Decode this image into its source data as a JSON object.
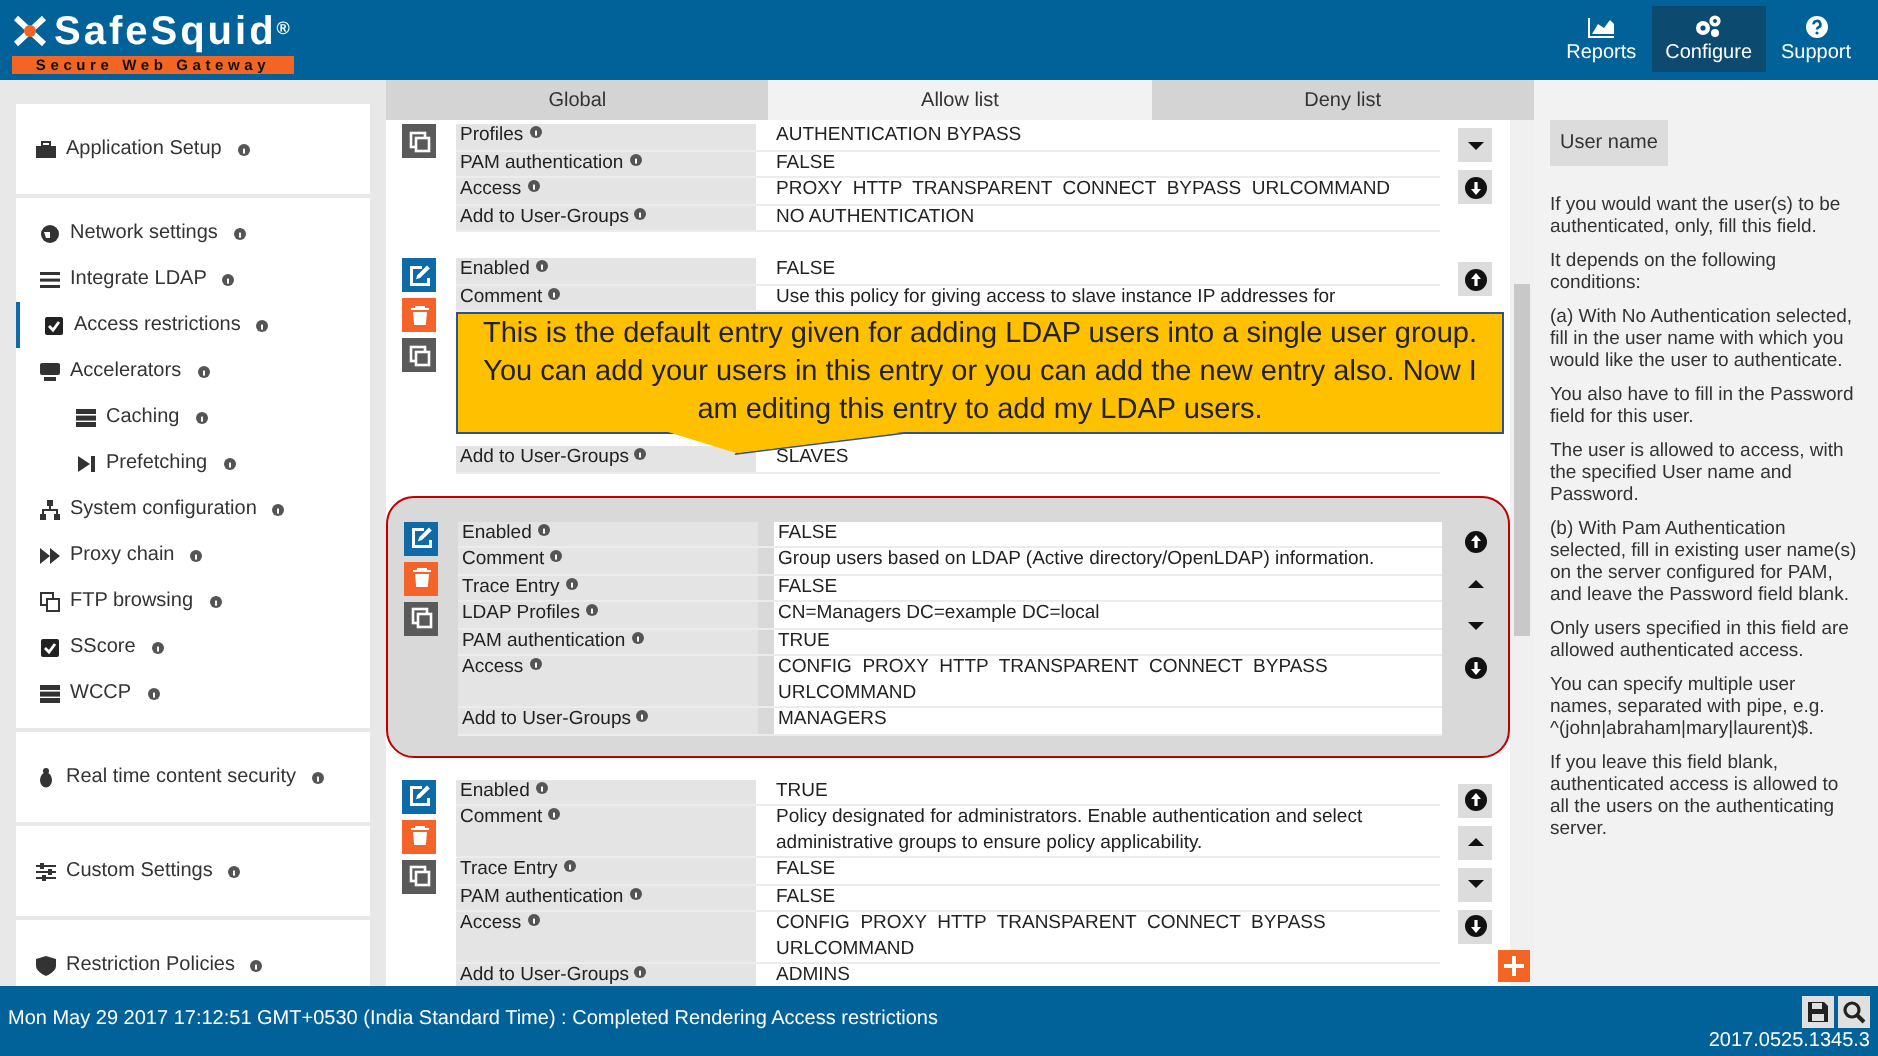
{
  "header": {
    "logo": {
      "name": "SafeSquid",
      "mark": "®",
      "tagline": "Secure Web Gateway"
    },
    "nav": [
      {
        "label": "Reports",
        "selected": false
      },
      {
        "label": "Configure",
        "selected": true
      },
      {
        "label": "Support",
        "selected": false
      }
    ]
  },
  "sidebar": {
    "groups": [
      {
        "items": [
          {
            "label": "Application Setup",
            "selected": false
          }
        ]
      },
      {
        "items": [
          {
            "label": "Network settings",
            "selected": false
          },
          {
            "label": "Integrate LDAP",
            "selected": false
          },
          {
            "label": "Access restrictions",
            "selected": true
          },
          {
            "label": "Accelerators",
            "selected": false,
            "children": [
              {
                "label": "Caching",
                "selected": false
              },
              {
                "label": "Prefetching",
                "selected": false
              }
            ]
          },
          {
            "label": "System configuration",
            "selected": false
          },
          {
            "label": "Proxy chain",
            "selected": false
          },
          {
            "label": "FTP browsing",
            "selected": false
          },
          {
            "label": "SScore",
            "selected": false
          },
          {
            "label": "WCCP",
            "selected": false
          }
        ]
      },
      {
        "items": [
          {
            "label": "Real time content security",
            "selected": false
          }
        ]
      },
      {
        "items": [
          {
            "label": "Custom Settings",
            "selected": false
          }
        ]
      },
      {
        "items": [
          {
            "label": "Restriction Policies",
            "selected": false
          }
        ]
      }
    ]
  },
  "tabs": [
    {
      "label": "Global",
      "selected": false
    },
    {
      "label": "Allow list",
      "selected": true
    },
    {
      "label": "Deny list",
      "selected": false
    }
  ],
  "entries": [
    {
      "highlighted": false,
      "actions": [
        {
          "kind": "duplicate"
        }
      ],
      "moves": [
        {
          "kind": "down"
        },
        {
          "kind": "bottom"
        }
      ],
      "fields": [
        {
          "label": "Profiles",
          "value": "AUTHENTICATION BYPASS"
        },
        {
          "label": "PAM authentication",
          "value": "FALSE"
        },
        {
          "label": "Access",
          "value": "PROXY  HTTP  TRANSPARENT  CONNECT  BYPASS  URLCOMMAND"
        },
        {
          "label": "Add to User-Groups",
          "value": "NO AUTHENTICATION"
        }
      ]
    },
    {
      "highlighted": false,
      "actions": [
        {
          "kind": "edit"
        },
        {
          "kind": "delete"
        },
        {
          "kind": "duplicate"
        }
      ],
      "moves": [
        {
          "kind": "top"
        }
      ],
      "fields": [
        {
          "label": "Enabled",
          "value": "FALSE"
        },
        {
          "label": "Comment",
          "value": "Use this policy for giving access to slave instance IP addresses for"
        },
        {
          "kind": "covered"
        },
        {
          "label": "Add to User-Groups",
          "value": "SLAVES"
        }
      ],
      "callout": "This is the default entry given  for adding LDAP users into a single user group. You can add your users in this entry or you can add the new entry also. Now I am editing this entry to add my LDAP users."
    },
    {
      "highlighted": true,
      "actions": [
        {
          "kind": "edit"
        },
        {
          "kind": "delete"
        },
        {
          "kind": "duplicate"
        }
      ],
      "moves": [
        {
          "kind": "top"
        },
        {
          "kind": "up"
        },
        {
          "kind": "down"
        },
        {
          "kind": "bottom"
        }
      ],
      "fields": [
        {
          "label": "Enabled",
          "value": "FALSE"
        },
        {
          "label": "Comment",
          "value": "Group users based on LDAP (Active directory/OpenLDAP) information."
        },
        {
          "label": "Trace Entry",
          "value": "FALSE"
        },
        {
          "label": "LDAP Profiles",
          "value": "CN=Managers DC=example DC=local"
        },
        {
          "label": "PAM authentication",
          "value": "TRUE"
        },
        {
          "label": "Access",
          "value": "CONFIG  PROXY  HTTP  TRANSPARENT  CONNECT  BYPASS URLCOMMAND"
        },
        {
          "label": "Add to User-Groups",
          "value": "MANAGERS"
        }
      ]
    },
    {
      "highlighted": false,
      "actions": [
        {
          "kind": "edit"
        },
        {
          "kind": "delete"
        },
        {
          "kind": "duplicate"
        }
      ],
      "moves": [
        {
          "kind": "top"
        },
        {
          "kind": "up"
        },
        {
          "kind": "down"
        },
        {
          "kind": "bottom"
        }
      ],
      "fields": [
        {
          "label": "Enabled",
          "value": "TRUE"
        },
        {
          "label": "Comment",
          "value": "Policy designated for administrators. Enable authentication and select administrative groups to ensure policy applicability."
        },
        {
          "label": "Trace Entry",
          "value": "FALSE"
        },
        {
          "label": "PAM authentication",
          "value": "FALSE"
        },
        {
          "label": "Access",
          "value": "CONFIG  PROXY  HTTP  TRANSPARENT  CONNECT  BYPASS URLCOMMAND"
        },
        {
          "label": "Add to User-Groups",
          "value": "ADMINS"
        }
      ]
    }
  ],
  "help": {
    "title": "User name",
    "paragraphs": [
      "If you would want the user(s) to be authenticated, only, fill this field.",
      "It depends on the following conditions:",
      "(a) With No Authentication selected, fill in the user name with which you would like the user to authenticate.",
      "You also have to fill in the Password field for this user.",
      "The user is allowed to access, with the specified User name and Password.",
      "(b) With Pam Authentication selected, fill in existing user name(s) on the server configured for PAM, and leave the Password field blank.",
      "Only users specified in this field are allowed authenticated access.",
      "You can specify multiple user names, separated with pipe, e.g. ^(john|abraham|mary|laurent)$.",
      "If you leave this field blank, authenticated access is allowed to all the users on the authenticating server."
    ]
  },
  "status_bar": {
    "message": "Mon May 29 2017 17:12:51 GMT+0530 (India Standard Time) : Completed Rendering Access restrictions",
    "version": "2017.0525.1345.3"
  }
}
